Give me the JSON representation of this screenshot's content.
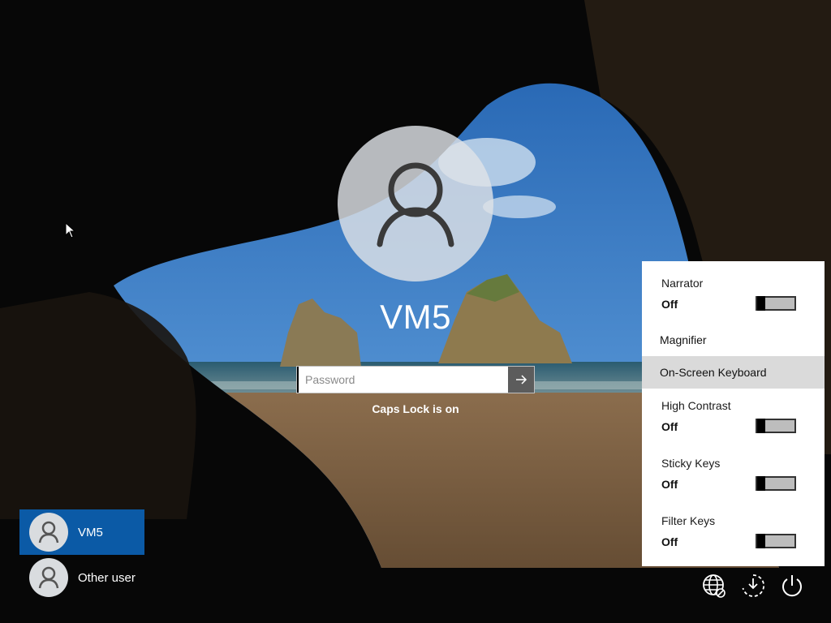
{
  "login": {
    "username": "VM5",
    "password_placeholder": "Password",
    "caps_lock_message": "Caps Lock is on"
  },
  "users": [
    {
      "name": "VM5",
      "selected": true
    },
    {
      "name": "Other user",
      "selected": false
    }
  ],
  "ease_of_access": {
    "narrator": {
      "label": "Narrator",
      "state": "Off"
    },
    "magnifier": {
      "label": "Magnifier"
    },
    "on_screen_keyboard": {
      "label": "On-Screen Keyboard"
    },
    "high_contrast": {
      "label": "High Contrast",
      "state": "Off"
    },
    "sticky_keys": {
      "label": "Sticky Keys",
      "state": "Off"
    },
    "filter_keys": {
      "label": "Filter Keys",
      "state": "Off"
    }
  },
  "corner_icons": [
    "network-icon",
    "ease-of-access-icon",
    "power-icon"
  ],
  "colors": {
    "selected_user": "#0b5aa6",
    "panel_bg": "#ffffff",
    "hover_row": "#dadada",
    "submit_button": "#5c5c5c"
  }
}
